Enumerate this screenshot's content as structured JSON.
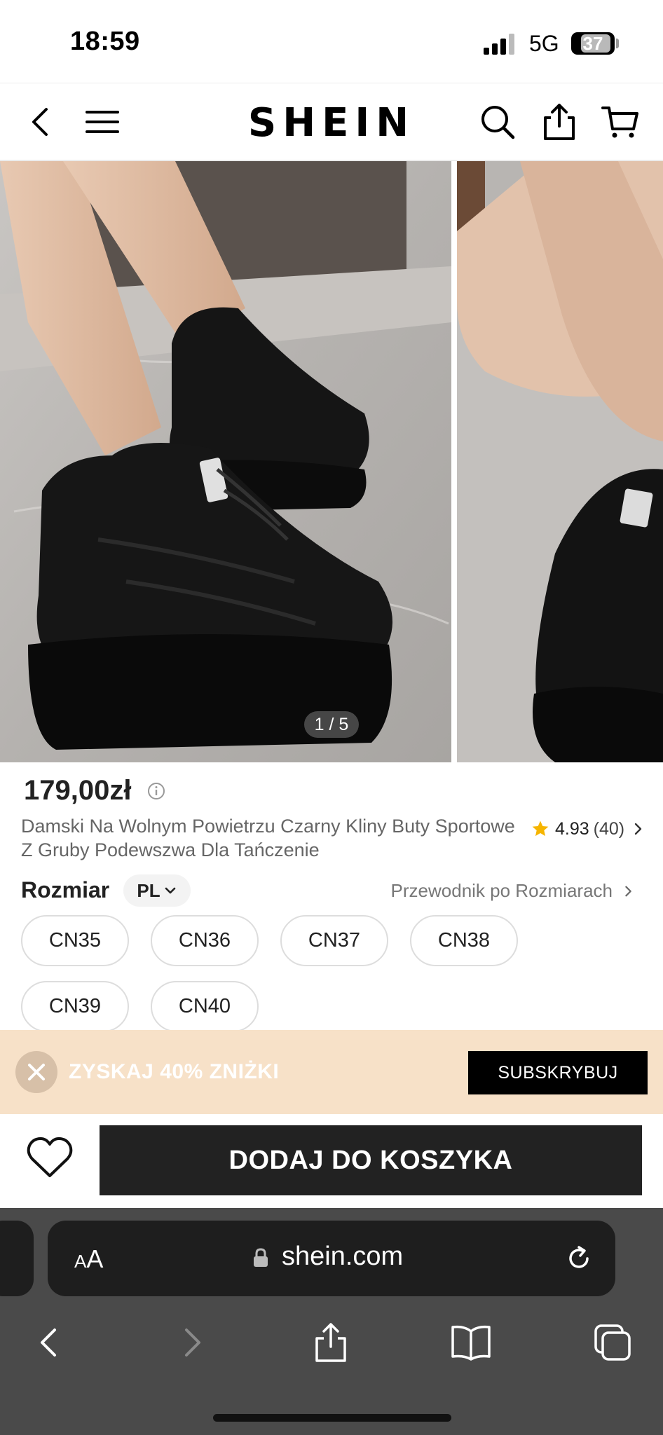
{
  "status_bar": {
    "time": "18:59",
    "network": "5G",
    "battery": "37",
    "battery_level": 0.37
  },
  "nav": {
    "brand": "SHEIN",
    "icons": [
      "back-icon",
      "menu-icon",
      "search-icon",
      "share-icon",
      "cart-icon"
    ]
  },
  "gallery": {
    "counter": "1 / 5"
  },
  "product": {
    "price": "179,00zł",
    "title": "Damski Na Wolnym Powietrzu Czarny Kliny Buty Sportowe Z Gruby Podewszwa Dla Tańczenie",
    "rating": "4.93",
    "rating_count": "(40)",
    "size_label": "Rozmiar",
    "size_locale": "PL",
    "size_guide": "Przewodnik po Rozmiarach",
    "sizes": [
      "CN35",
      "CN36",
      "CN37",
      "CN38",
      "CN39",
      "CN40"
    ]
  },
  "promo": {
    "text": "ZYSKAJ 40% ZNIŻKI",
    "button": "SUBSKRYBUJ"
  },
  "cart": {
    "add_label": "DODAJ DO KOSZYKA"
  },
  "browser": {
    "text_size_label": "AA",
    "url": "shein.com"
  },
  "colors": {
    "promo_bg": "#f7e1c8",
    "star": "#f6b500",
    "button": "#222222",
    "browser_bg": "#4a4a4a"
  }
}
